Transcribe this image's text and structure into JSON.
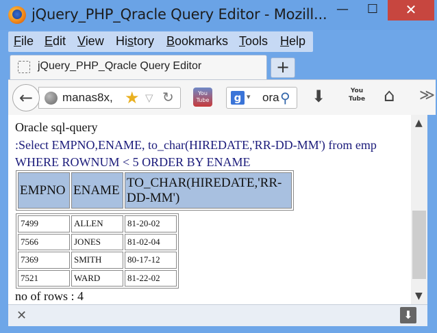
{
  "window": {
    "title": "jQuery_PHP_Qracle Query Editor - Mozill...",
    "minimize": "—",
    "maximize": "☐",
    "close": "✕"
  },
  "menu": [
    {
      "pre": "",
      "acc": "F",
      "post": "ile"
    },
    {
      "pre": "",
      "acc": "E",
      "post": "dit"
    },
    {
      "pre": "",
      "acc": "V",
      "post": "iew"
    },
    {
      "pre": "Hi",
      "acc": "s",
      "post": "tory"
    },
    {
      "pre": "",
      "acc": "B",
      "post": "ookmarks"
    },
    {
      "pre": "",
      "acc": "T",
      "post": "ools"
    },
    {
      "pre": "",
      "acc": "H",
      "post": "elp"
    }
  ],
  "tab": {
    "title": "jQuery_PHP_Qracle Query Editor",
    "new_tab": "+"
  },
  "nav": {
    "back": "←",
    "url": "manas8x,",
    "star": "★",
    "dropdown": "▽",
    "reload": "↻",
    "search_engine": "g",
    "search_text": "ora",
    "search_icon": "⚲",
    "download": "⬇",
    "youtube_label": "You Tube",
    "home": "⌂",
    "more": "≫"
  },
  "page": {
    "heading": "Oracle sql-query",
    "query": ":Select EMPNO,ENAME, to_char(HIREDATE,'RR-DD-MM') from emp WHERE ROWNUM < 5 ORDER BY ENAME",
    "columns": [
      "EMPNO",
      "ENAME",
      "TO_CHAR(HIREDATE,'RR-DD-MM')"
    ],
    "rows": [
      [
        "7499",
        "ALLEN",
        "81-20-02"
      ],
      [
        "7566",
        "JONES",
        "81-02-04"
      ],
      [
        "7369",
        "SMITH",
        "80-17-12"
      ],
      [
        "7521",
        "WARD",
        "81-22-02"
      ]
    ],
    "row_count": "no of rows : 4"
  },
  "scrollbar": {
    "up": "▲",
    "down": "▼"
  },
  "bottom": {
    "close": "✕",
    "download": "⬇"
  },
  "icons": {
    "firefox": "firefox-logo-icon",
    "globe": "globe-icon",
    "star": "star-icon",
    "home": "home-icon"
  }
}
